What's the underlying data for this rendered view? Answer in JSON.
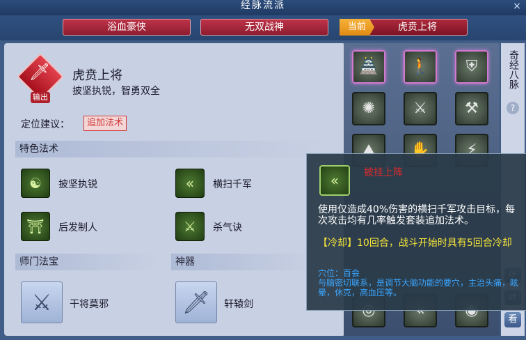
{
  "window": {
    "title": "经脉流派",
    "close_icon": "×"
  },
  "tabs": [
    {
      "label": "浴血豪侠",
      "active": false
    },
    {
      "label": "无双战神",
      "active": false
    },
    {
      "current_tag": "当前",
      "label": "虎贲上将",
      "active": true
    }
  ],
  "school": {
    "name": "虎贲上将",
    "description": "披坚执锐，智勇双全",
    "badge": "输出",
    "position_label": "定位建议：",
    "position_tag": "追加法术"
  },
  "sections": {
    "special_spells": "特色法术",
    "master_treasure": "师门法宝",
    "artifact": "神器"
  },
  "skills": [
    {
      "label": "披坚执锐",
      "icon": "gourd-icon"
    },
    {
      "label": "横扫千军",
      "icon": "arrows-icon"
    },
    {
      "label": "后发制人",
      "icon": "gate-icon"
    },
    {
      "label": "杀气诀",
      "icon": "slash-icon"
    }
  ],
  "treasure": {
    "label": "干将莫邪",
    "icon": "crossed-swords-icon"
  },
  "artifact": {
    "label": "轩辕剑",
    "icon": "sword-icon"
  },
  "sidebar": {
    "title": "奇经八脉",
    "help": "?",
    "buttons": [
      "⟳",
      "⇄",
      "看"
    ]
  },
  "tooltip": {
    "title": "披挂上阵",
    "description": "使用仅造成40%伤害的横扫千军攻击目标，每次攻击均有几率触发套装追加法术。",
    "cooldown": "【冷却】10回合，战斗开始时具有5回合冷却",
    "acupoint": "穴位：百会\n与脑密切联系，是调节大脑功能的要穴，主治头痛，眩晕，休克，高血压等。"
  },
  "colors": {
    "accent": "#b5293d",
    "current_tag": "#f0a020",
    "tooltip_cd": "#f6e63a",
    "tooltip_acu": "#3aa6ff"
  }
}
